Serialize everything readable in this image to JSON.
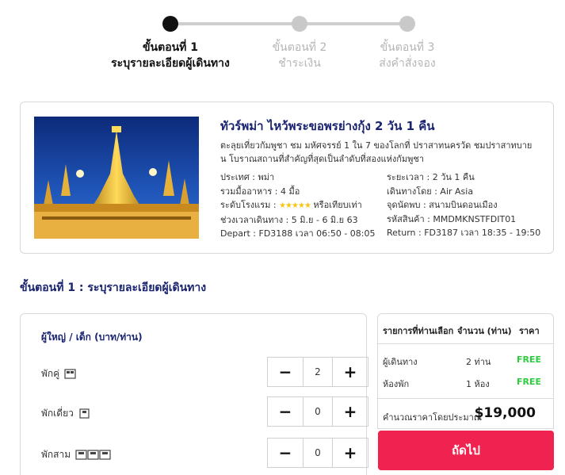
{
  "steps": [
    {
      "number": "ขั้นตอนที่ 1",
      "label": "ระบุรายละเอียดผู้เดินทาง"
    },
    {
      "number": "ขั้นตอนที่ 2",
      "label": "ชำระเงิน"
    },
    {
      "number": "ขั้นตอนที่ 3",
      "label": "ส่งคำสั่งจอง"
    }
  ],
  "tour": {
    "title": "ทัวร์พม่า ไหว้พระขอพรย่างกุ้ง 2 วัน 1 คืน",
    "description": "ตะลุยเที่ยวกัมพูชา ชม มหัศจรรย์ 1 ใน 7 ของโลกที่ ปราสาทนครวัด ชมปราสาทบายน โบราณสถานที่สำคัญที่สุดเป็นลำดับที่สองแห่งกัมพูชา",
    "country": "ประเทศ : พม่า",
    "meals": "รวมมื้ออาหาร : 4 มื้อ",
    "hotel_prefix": "ระดับโรงแรม :",
    "hotel_stars": "★★★★★",
    "hotel_suffix": "หรือเทียบเท่า",
    "period": "ช่วงเวลาเดินทาง : 5 มิ.ย - 6 มิ.ย 63",
    "depart": "Depart : FD3188 เวลา 06:50 - 08:05",
    "duration": "ระยะเวลา : 2 วัน 1 คืน",
    "airline": "เดินทางโดย : Air Asia",
    "meeting_point": "จุดนัดพบ : สนามบินดอนเมือง",
    "product_code": "รหัสสินค้า : MMDMKNSTFDIT01",
    "return": "Return : FD3187 เวลา 18:35 - 19:50"
  },
  "section_heading": "ขั้นตอนที่ 1 : ระบุรายละเอียดผู้เดินทาง",
  "rooms": {
    "header": "ผู้ใหญ่ / เด็ก (บาท/ท่าน)",
    "items": [
      {
        "label": "พักคู่",
        "value": "2"
      },
      {
        "label": "พักเดี่ยว",
        "value": "0"
      },
      {
        "label": "พักสาม",
        "value": "0"
      }
    ],
    "minus_symbol": "−",
    "plus_symbol": "+"
  },
  "summary": {
    "col_item": "รายการที่ท่านเลือก",
    "col_qty": "จำนวน (ท่าน)",
    "col_price": "ราคา",
    "rows": [
      {
        "item": "ผู้เดินทาง",
        "qty": "2 ท่าน",
        "price": "FREE"
      },
      {
        "item": "ห้องพัก",
        "qty": "1 ห้อง",
        "price": "FREE"
      }
    ],
    "total_label": "คำนวณราคาโดยประมาณ",
    "total_amount": "$19,000"
  },
  "next_button": "ถัดไป",
  "colors": {
    "accent": "#f0224f",
    "title_navy": "#1a2470",
    "free_green": "#2ecc40",
    "step_active": "#111111",
    "step_inactive": "#c9c9c9"
  }
}
